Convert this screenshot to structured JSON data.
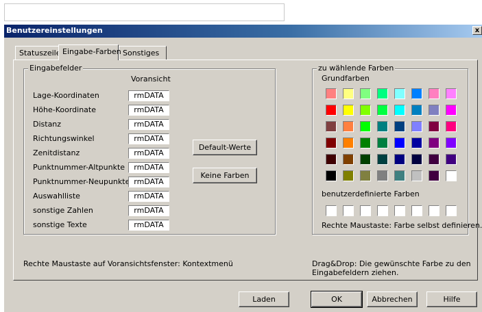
{
  "window": {
    "title": "Benutzereinstellungen",
    "close_label": "x"
  },
  "tabs": [
    {
      "label": "Statuszeile",
      "active": false
    },
    {
      "label": "Eingabe-Farben",
      "active": true
    },
    {
      "label": "Sonstiges",
      "active": false
    }
  ],
  "input_fields": {
    "group_title": "Eingabefelder",
    "preview_header": "Voransicht",
    "rows": [
      {
        "label": "Lage-Koordinaten",
        "preview": "rmDATA"
      },
      {
        "label": "Höhe-Koordinate",
        "preview": "rmDATA"
      },
      {
        "label": "Distanz",
        "preview": "rmDATA"
      },
      {
        "label": "Richtungswinkel",
        "preview": "rmDATA"
      },
      {
        "label": "Zenitdistanz",
        "preview": "rmDATA"
      },
      {
        "label": "Punktnummer-Altpunkte",
        "preview": "rmDATA"
      },
      {
        "label": "Punktnummer-Neupunkte",
        "preview": "rmDATA"
      },
      {
        "label": "Auswahlliste",
        "preview": "rmDATA"
      },
      {
        "label": "sonstige Zahlen",
        "preview": "rmDATA"
      },
      {
        "label": "sonstige Texte",
        "preview": "rmDATA"
      }
    ],
    "default_button": "Default-Werte",
    "no_colors_button": "Keine Farben"
  },
  "colors": {
    "group_title": "zu wählende Farben",
    "basic_title": "Grundfarben",
    "basic": [
      [
        "#ff8080",
        "#ffff80",
        "#80ff80",
        "#00ff80",
        "#80ffff",
        "#0080ff",
        "#ff80c0",
        "#ff80ff"
      ],
      [
        "#ff0000",
        "#ffff00",
        "#80ff00",
        "#00ff40",
        "#00ffff",
        "#0080c0",
        "#8080c0",
        "#ff00ff"
      ],
      [
        "#804040",
        "#ff8040",
        "#00ff00",
        "#008080",
        "#004080",
        "#8080ff",
        "#800040",
        "#ff0080"
      ],
      [
        "#800000",
        "#ff8000",
        "#008000",
        "#008040",
        "#0000ff",
        "#0000a0",
        "#800080",
        "#8000ff"
      ],
      [
        "#400000",
        "#804000",
        "#004000",
        "#004040",
        "#000080",
        "#000040",
        "#400040",
        "#400080"
      ],
      [
        "#000000",
        "#808000",
        "#808040",
        "#808080",
        "#408080",
        "#c0c0c0",
        "#400040",
        "#ffffff"
      ]
    ],
    "custom_title": "benutzerdefinierte Farben",
    "custom": [
      "#ffffff",
      "#ffffff",
      "#ffffff",
      "#ffffff",
      "#ffffff",
      "#ffffff",
      "#ffffff",
      "#ffffff"
    ],
    "custom_hint": "Rechte Maustaste: Farbe selbst definieren."
  },
  "hints": {
    "left": "Rechte Maustaste auf Voransichtsfenster: Kontextmenü",
    "right": "Drag&Drop: Die gewünschte Farbe zu den Eingabefeldern ziehen."
  },
  "buttons": {
    "load": "Laden",
    "ok": "OK",
    "cancel": "Abbrechen",
    "help": "Hilfe"
  }
}
